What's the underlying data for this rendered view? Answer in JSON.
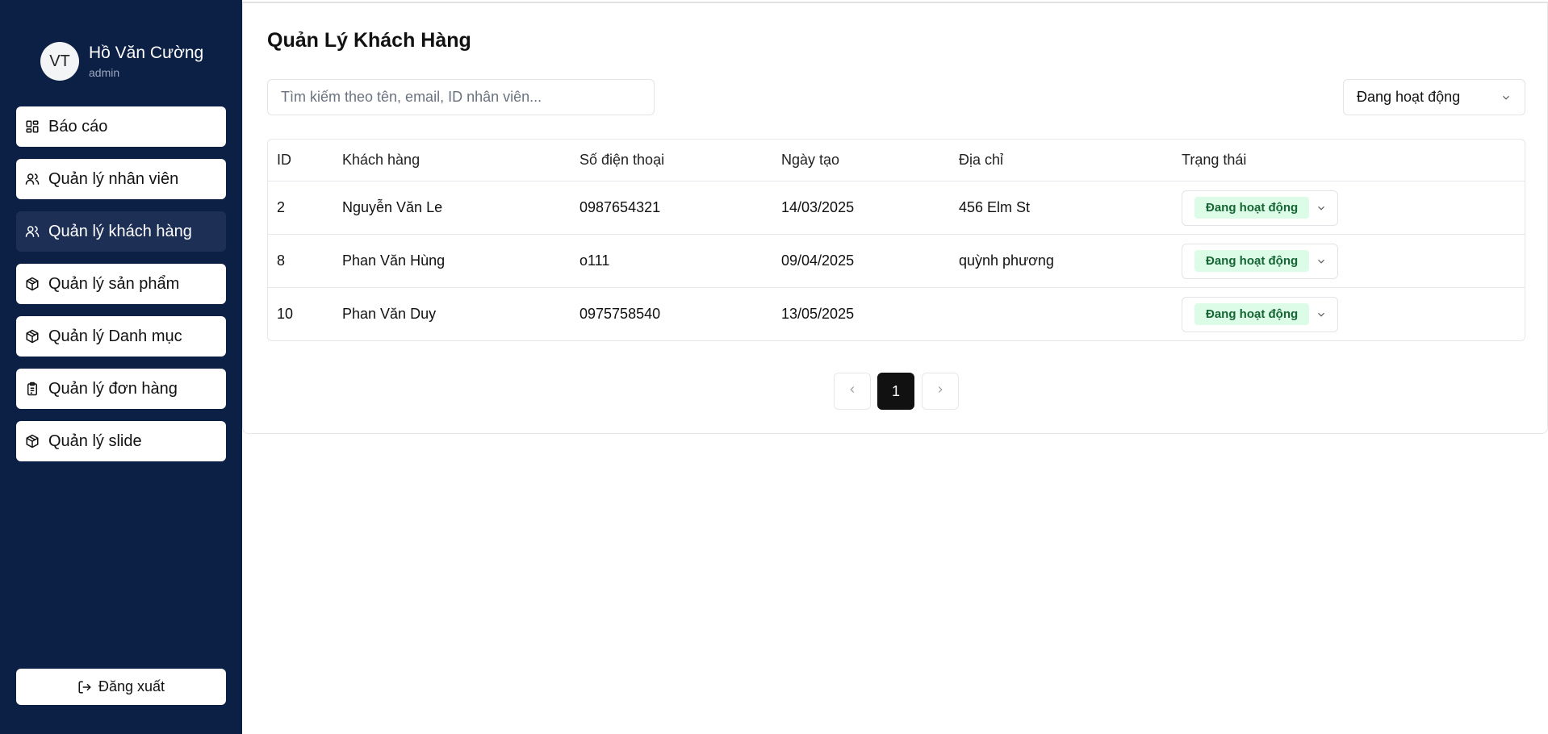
{
  "sidebar": {
    "user": {
      "initials": "VT",
      "name": "Hồ Văn Cường",
      "role": "admin"
    },
    "items": [
      {
        "label": "Báo cáo",
        "icon": "dashboard-icon",
        "active": false
      },
      {
        "label": "Quản lý nhân viên",
        "icon": "users-icon",
        "active": false
      },
      {
        "label": "Quản lý khách hàng",
        "icon": "users-icon",
        "active": true
      },
      {
        "label": "Quản lý sản phẩm",
        "icon": "package-icon",
        "active": false
      },
      {
        "label": "Quản lý Danh mục",
        "icon": "package-icon",
        "active": false
      },
      {
        "label": "Quản lý đơn hàng",
        "icon": "clipboard-icon",
        "active": false
      },
      {
        "label": "Quản lý slide",
        "icon": "package-icon",
        "active": false
      }
    ],
    "logout_label": "Đăng xuất"
  },
  "main": {
    "title": "Quản Lý Khách Hàng",
    "search_placeholder": "Tìm kiếm theo tên, email, ID nhân viên...",
    "filter_value": "Đang hoạt động",
    "table": {
      "headers": [
        "ID",
        "Khách hàng",
        "Số điện thoại",
        "Ngày tạo",
        "Địa chỉ",
        "Trạng thái"
      ],
      "rows": [
        {
          "id": "2",
          "name": "Nguyễn Văn Le",
          "phone": "0987654321",
          "date": "14/03/2025",
          "address": "456 Elm St",
          "status": "Đang hoạt động"
        },
        {
          "id": "8",
          "name": "Phan Văn Hùng",
          "phone": "o111",
          "date": "09/04/2025",
          "address": "quỳnh phương",
          "status": "Đang hoạt động"
        },
        {
          "id": "10",
          "name": "Phan Văn Duy",
          "phone": "0975758540",
          "date": "13/05/2025",
          "address": "",
          "status": "Đang hoạt động"
        }
      ]
    },
    "pagination": {
      "current_page": "1"
    }
  },
  "colors": {
    "sidebar_bg": "#0c1f45",
    "active_item_bg": "#1d2f55",
    "badge_bg": "#dcfce7",
    "badge_text": "#166534",
    "current_page_bg": "#111111"
  }
}
